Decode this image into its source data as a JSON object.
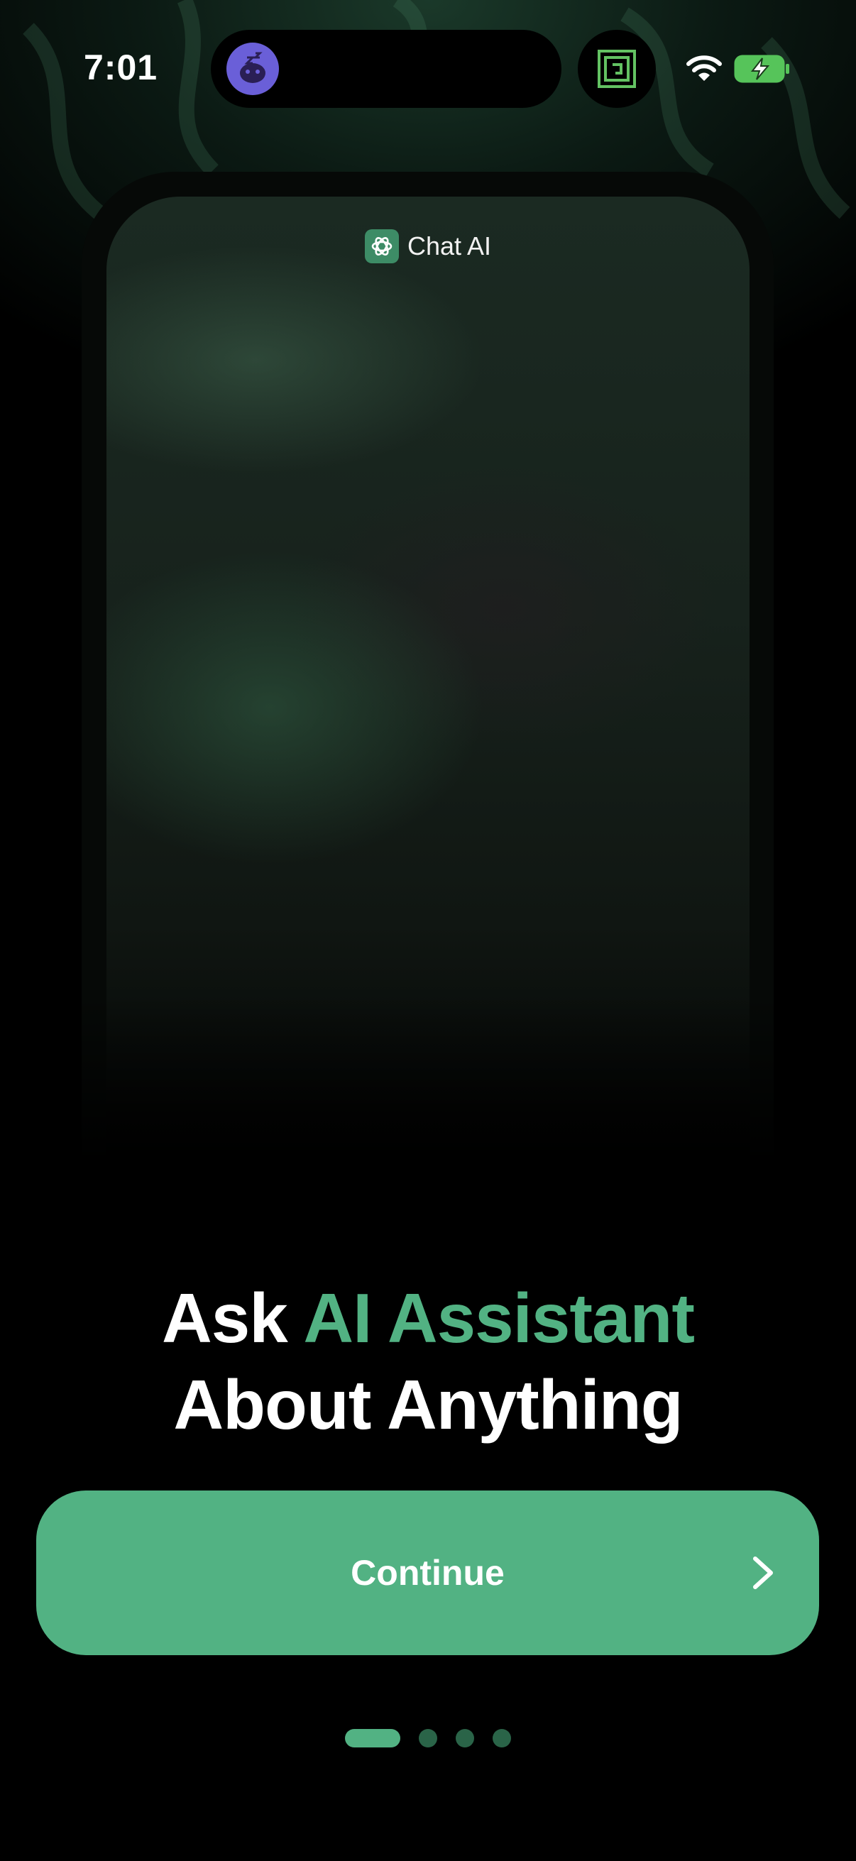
{
  "status_bar": {
    "time": "7:01",
    "icons": [
      "sleep-app-icon",
      "game-app-icon",
      "wifi-icon",
      "battery-charging-icon"
    ]
  },
  "preview": {
    "app_name": "Chat AI",
    "app_icon": "chat-ai-logo-icon"
  },
  "headline": {
    "prefix": "Ask ",
    "accent": "AI Assistant",
    "line2": "About Anything"
  },
  "continue_button": {
    "label": "Continue",
    "icon": "chevron-right-icon"
  },
  "pagination": {
    "total": 4,
    "current": 1
  },
  "colors": {
    "accent": "#52b283",
    "background": "#000000",
    "dot_inactive": "#2a6448"
  }
}
